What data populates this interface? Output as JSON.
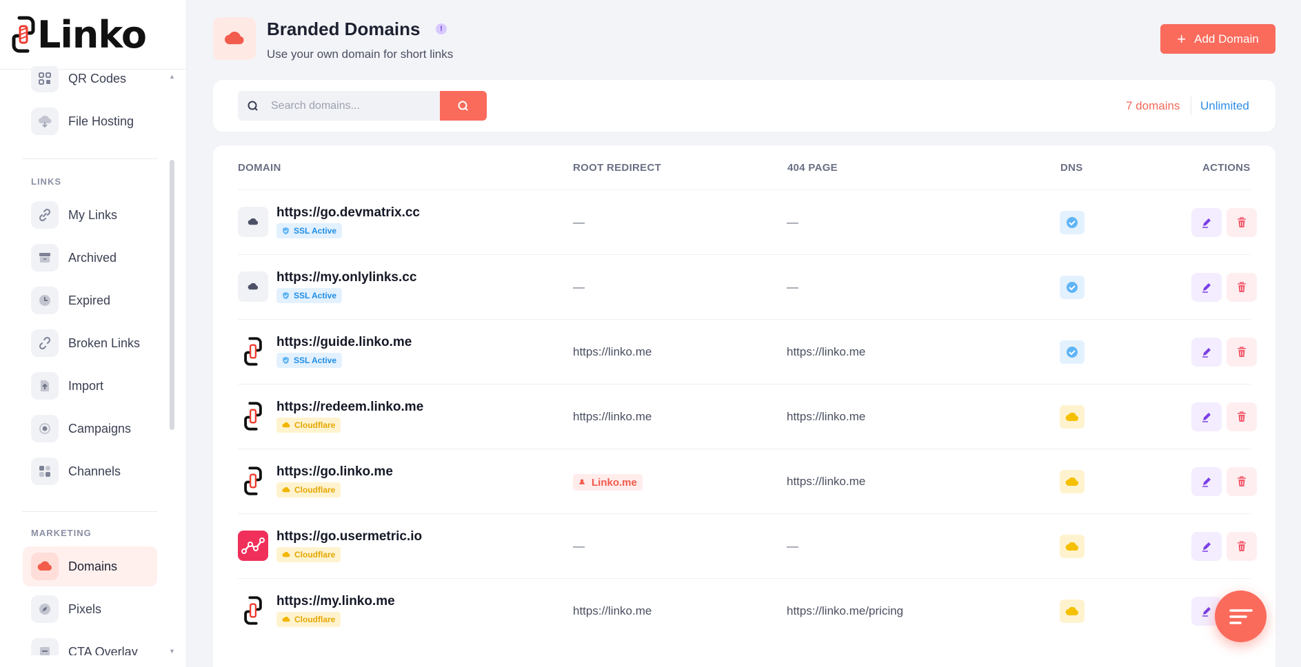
{
  "app": {
    "name": "Linko"
  },
  "sidebar": {
    "top_items": [
      {
        "label": "QR Codes",
        "icon": "qr-code-icon"
      },
      {
        "label": "File Hosting",
        "icon": "cloud-upload-icon"
      }
    ],
    "links_section": {
      "title": "LINKS",
      "items": [
        {
          "label": "My Links",
          "icon": "link-icon"
        },
        {
          "label": "Archived",
          "icon": "archive-icon"
        },
        {
          "label": "Expired",
          "icon": "clock-icon"
        },
        {
          "label": "Broken Links",
          "icon": "broken-link-icon"
        },
        {
          "label": "Import",
          "icon": "import-icon"
        },
        {
          "label": "Campaigns",
          "icon": "target-icon"
        },
        {
          "label": "Channels",
          "icon": "grid-icon"
        }
      ]
    },
    "marketing_section": {
      "title": "MARKETING",
      "items": [
        {
          "label": "Domains",
          "icon": "cloud-icon",
          "active": true
        },
        {
          "label": "Pixels",
          "icon": "compass-icon"
        },
        {
          "label": "CTA Overlay",
          "icon": "overlay-icon"
        }
      ]
    }
  },
  "header": {
    "title": "Branded Domains",
    "info_badge": "!",
    "subtitle": "Use your own domain for short links",
    "add_button": "Add Domain"
  },
  "search": {
    "placeholder": "Search domains...",
    "count_label": "7 domains",
    "limit_label": "Unlimited"
  },
  "table": {
    "headers": {
      "domain": "DOMAIN",
      "root_redirect": "ROOT REDIRECT",
      "not_found": "404 PAGE",
      "dns": "DNS",
      "actions": "ACTIONS"
    },
    "rows": [
      {
        "domain": "https://go.devmatrix.cc",
        "favicon": "cloud",
        "badge": "SSL Active",
        "badge_type": "ssl",
        "root_redirect": "—",
        "not_found": "—",
        "dns": "ok"
      },
      {
        "domain": "https://my.onlylinks.cc",
        "favicon": "cloud",
        "badge": "SSL Active",
        "badge_type": "ssl",
        "root_redirect": "—",
        "not_found": "—",
        "dns": "ok"
      },
      {
        "domain": "https://guide.linko.me",
        "favicon": "linko",
        "badge": "SSL Active",
        "badge_type": "ssl",
        "root_redirect": "https://linko.me",
        "not_found": "https://linko.me",
        "dns": "ok"
      },
      {
        "domain": "https://redeem.linko.me",
        "favicon": "linko",
        "badge": "Cloudflare",
        "badge_type": "cf",
        "root_redirect": "https://linko.me",
        "not_found": "https://linko.me",
        "dns": "cf"
      },
      {
        "domain": "https://go.linko.me",
        "favicon": "linko",
        "badge": "Cloudflare",
        "badge_type": "cf",
        "root_redirect_tag": "Linko.me",
        "not_found": "https://linko.me",
        "dns": "cf"
      },
      {
        "domain": "https://go.usermetric.io",
        "favicon": "metric",
        "badge": "Cloudflare",
        "badge_type": "cf",
        "root_redirect": "—",
        "not_found": "—",
        "dns": "cf"
      },
      {
        "domain": "https://my.linko.me",
        "favicon": "linko",
        "badge": "Cloudflare",
        "badge_type": "cf",
        "root_redirect": "https://linko.me",
        "not_found": "https://linko.me/pricing",
        "dns": "cf"
      }
    ]
  },
  "colors": {
    "accent": "#fa6b5c",
    "ssl": "#1f8de6",
    "cloudflare": "#e5a600",
    "edit": "#7b3fe4",
    "delete": "#f15a6c"
  }
}
